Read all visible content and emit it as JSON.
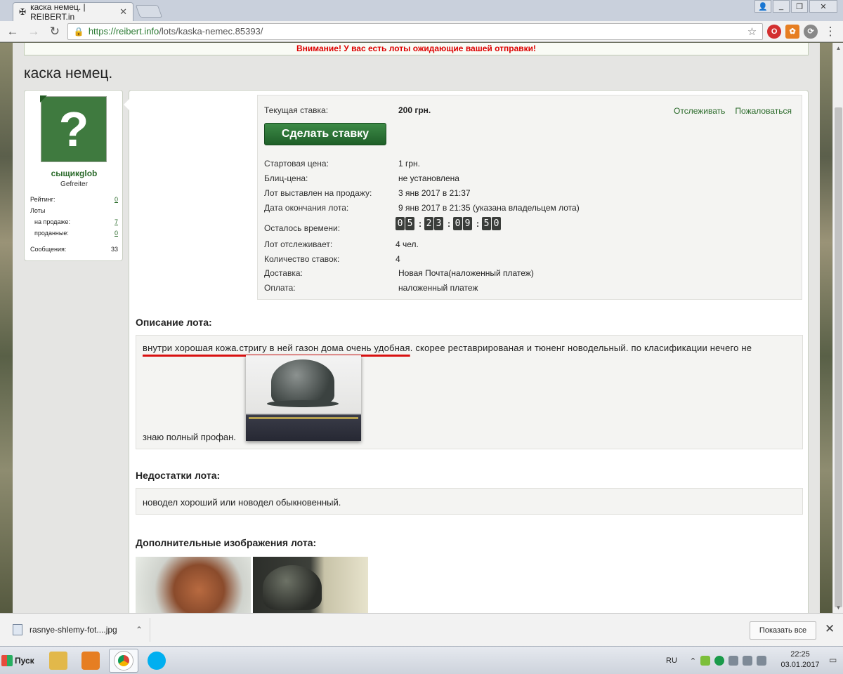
{
  "browser": {
    "tab_title": "каска немец. | REIBERT.in",
    "url_scheme": "https://",
    "url_host": "reibert.info",
    "url_path": "/lots/kaska-nemec.85393/",
    "window_controls": [
      "user",
      "minimize",
      "maximize",
      "close"
    ]
  },
  "page": {
    "alert": "Внимание! У вас есть лоты ожидающие вашей отправки!",
    "title": "каска немец."
  },
  "user": {
    "name": "сыщикglob",
    "rank": "Gefreiter",
    "rating_label": "Рейтинг:",
    "rating_value": "0",
    "lots_label": "Лоты",
    "on_sale_label": "на продаже:",
    "on_sale_value": "7",
    "sold_label": "проданные:",
    "sold_value": "0",
    "messages_label": "Сообщения:",
    "messages_value": "33"
  },
  "lot": {
    "current_bid_label": "Текущая ставка:",
    "current_bid_value": "200 грн.",
    "bid_button": "Сделать ставку",
    "watch_link": "Отслеживать",
    "report_link": "Пожаловаться",
    "start_price_label": "Стартовая цена:",
    "start_price_value": "1 грн.",
    "blitz_label": "Блиц-цена:",
    "blitz_value": "не установлена",
    "listed_label": "Лот выставлен на продажу:",
    "listed_value": "3 янв 2017 в 21:37",
    "end_label": "Дата окончания лота:",
    "end_value": "9 янв 2017 в 21:35 (указана владельцем лота)",
    "time_left_label": "Осталось времени:",
    "timer": {
      "d": "05",
      "h": "23",
      "m": "09",
      "s": "50"
    },
    "watchers_label": "Лот отслеживает:",
    "watchers_value": "4 чел.",
    "bids_label": "Количество ставок:",
    "bids_value": "4",
    "delivery_label": "Доставка:",
    "delivery_value": "Новая Почта(наложенный платеж)",
    "payment_label": "Оплата:",
    "payment_value": "наложенный платеж"
  },
  "description": {
    "heading": "Описание лота:",
    "text_underlined": "внутри хорошая кожа.стригу в ней газон дома очень удобная",
    "text_rest": ". скорее реставрированая и тюненг новодельный. по класификации нечего не",
    "text_line2": "знаю полный профан."
  },
  "defects": {
    "heading": "Недостатки лота:",
    "text": "новодел хороший или новодел обыкновенный."
  },
  "extra_images": {
    "heading": "Дополнительные изображения лота:"
  },
  "downloads": {
    "file_name": "rasnye-shlemy-fot....jpg",
    "show_all": "Показать все"
  },
  "taskbar": {
    "start_label": "Пуск",
    "lang": "RU",
    "time": "22:25",
    "date": "03.01.2017"
  },
  "colors": {
    "accent_green": "#2a6a2a",
    "alert_red": "#dd0000",
    "button_green": "#2e7a38"
  }
}
